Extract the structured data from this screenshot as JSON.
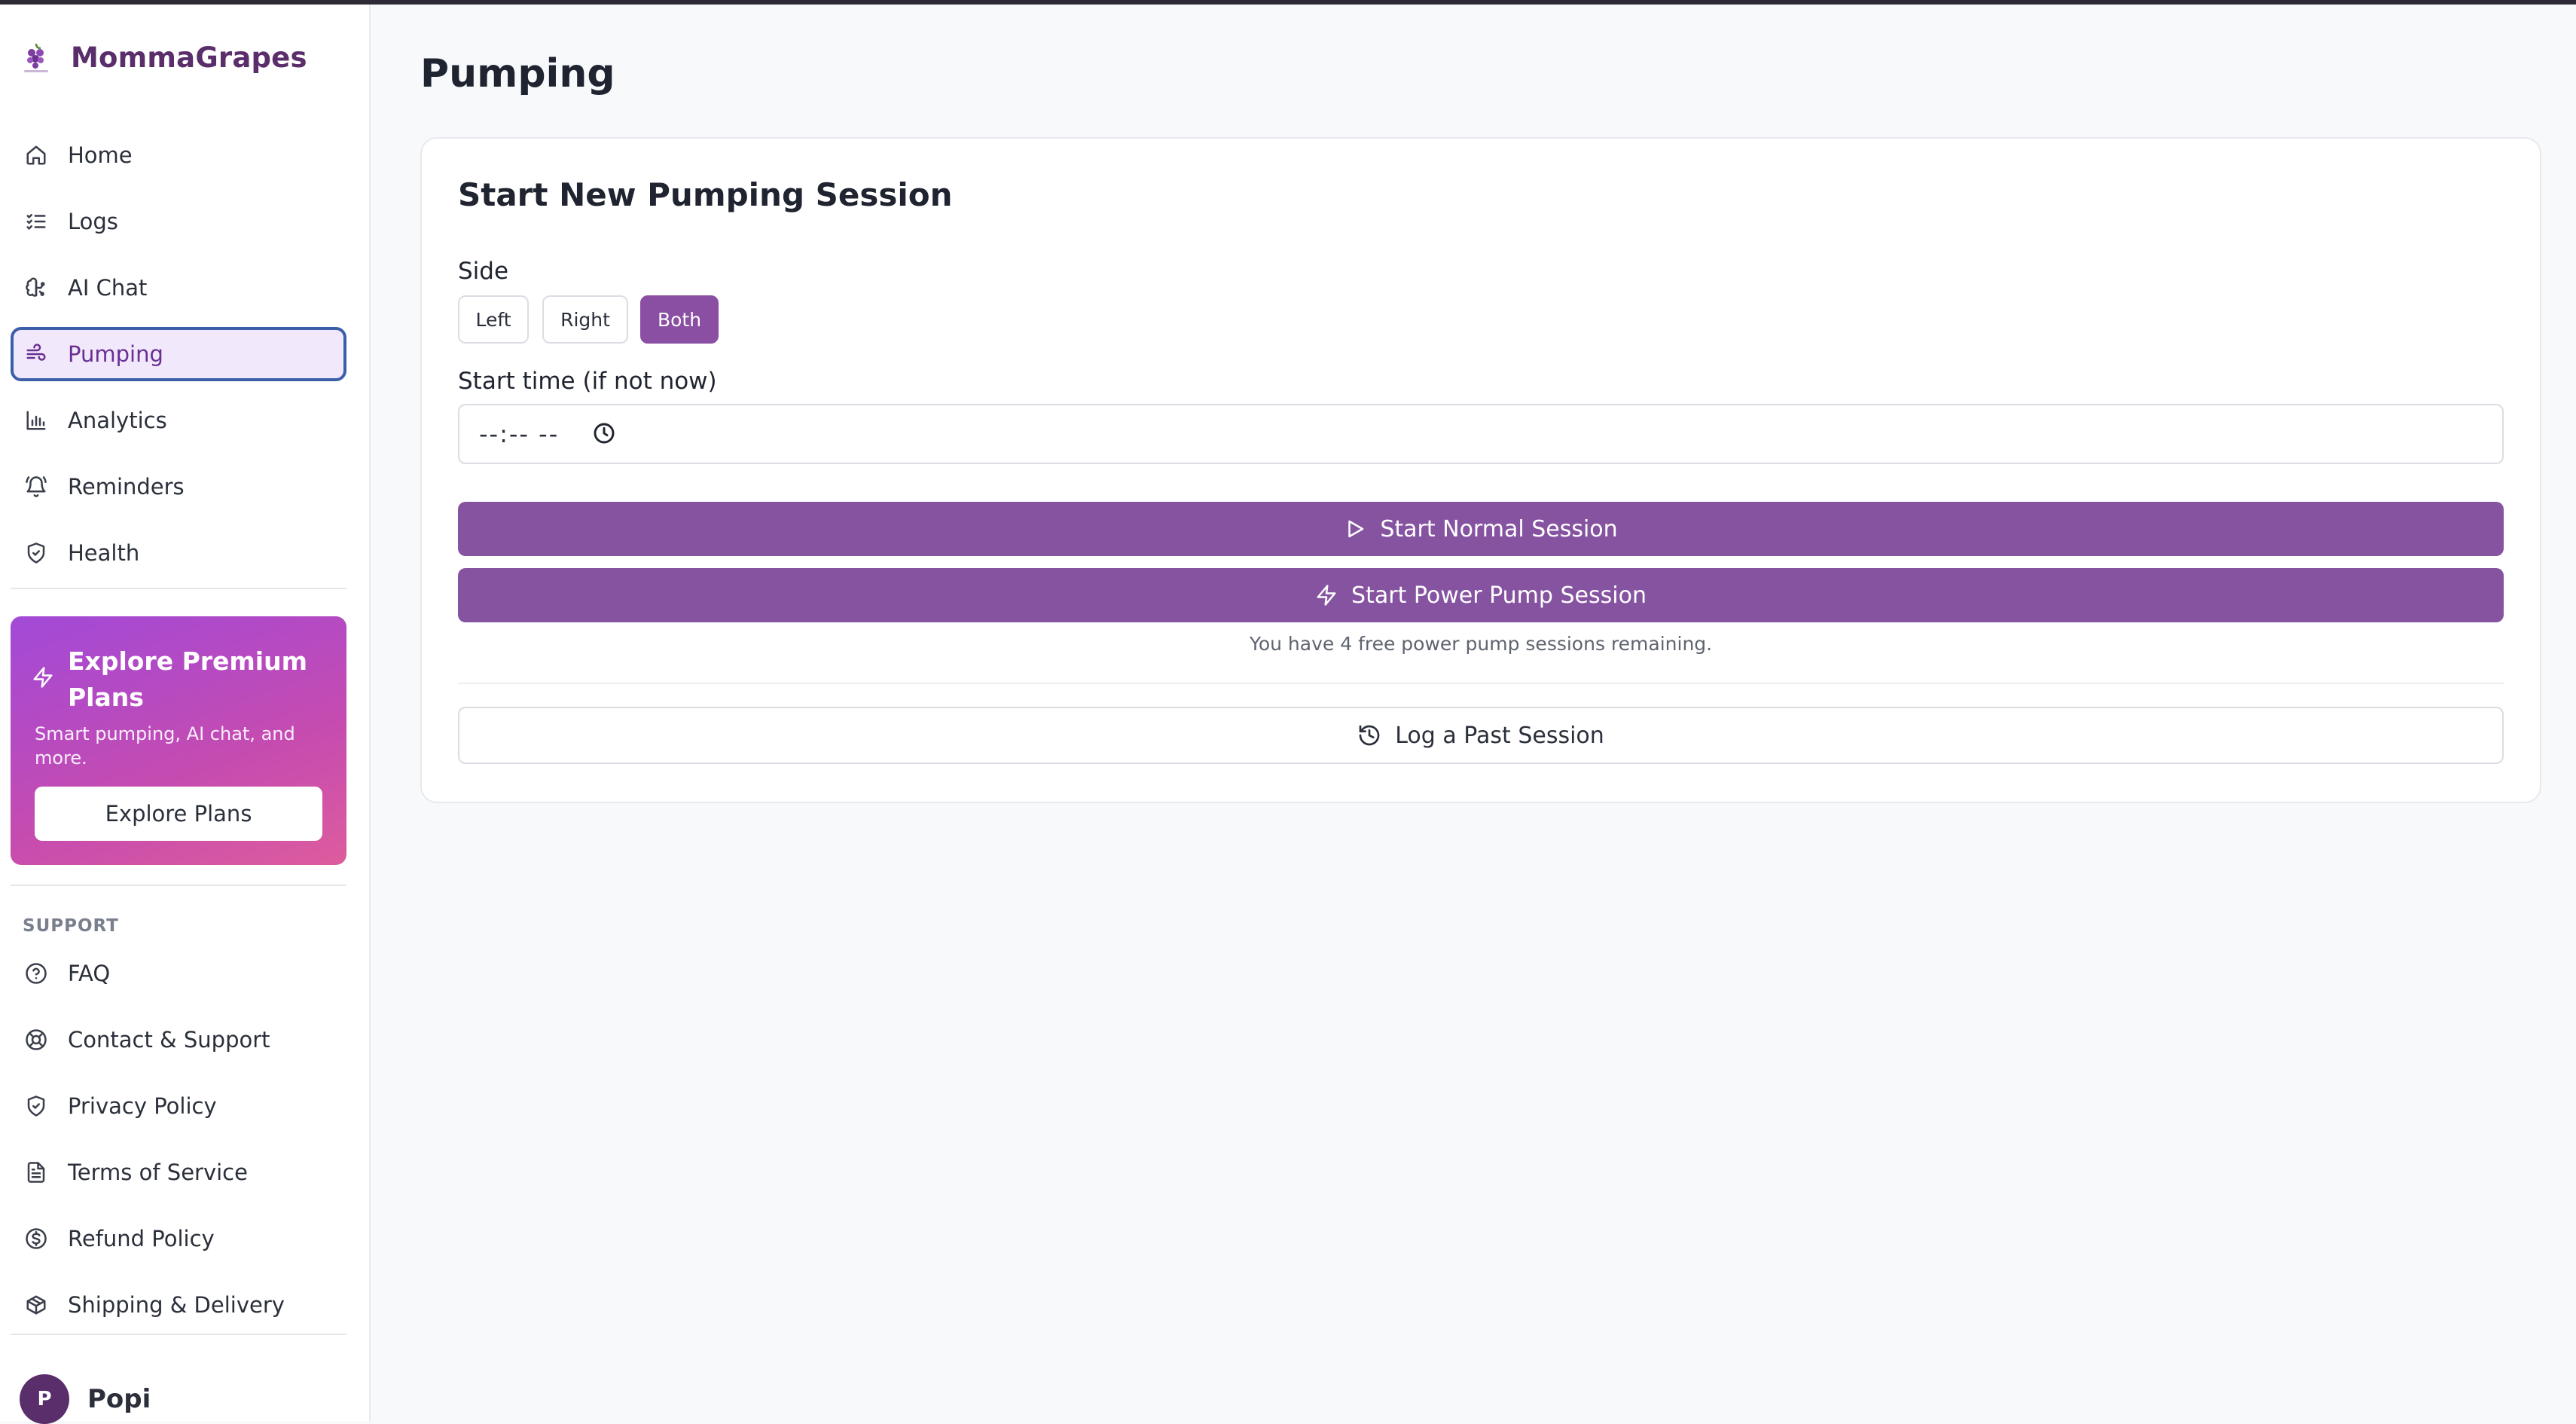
{
  "app": {
    "name": "MommaGrapes"
  },
  "nav": {
    "items": [
      {
        "label": "Home",
        "icon": "home-icon"
      },
      {
        "label": "Logs",
        "icon": "list-checks-icon"
      },
      {
        "label": "AI Chat",
        "icon": "brain-icon"
      },
      {
        "label": "Pumping",
        "icon": "wind-icon",
        "active": true
      },
      {
        "label": "Analytics",
        "icon": "bar-chart-icon"
      },
      {
        "label": "Reminders",
        "icon": "bell-icon"
      },
      {
        "label": "Health",
        "icon": "shield-check-icon"
      }
    ]
  },
  "promo": {
    "title": "Explore Premium Plans",
    "description": "Smart pumping, AI chat, and more.",
    "button": "Explore Plans"
  },
  "support": {
    "label": "SUPPORT",
    "items": [
      {
        "label": "FAQ",
        "icon": "help-circle-icon"
      },
      {
        "label": "Contact & Support",
        "icon": "life-buoy-icon"
      },
      {
        "label": "Privacy Policy",
        "icon": "shield-icon"
      },
      {
        "label": "Terms of Service",
        "icon": "file-text-icon"
      },
      {
        "label": "Refund Policy",
        "icon": "dollar-circle-icon"
      },
      {
        "label": "Shipping & Delivery",
        "icon": "package-icon"
      }
    ]
  },
  "user": {
    "initial": "P",
    "name": "Popi"
  },
  "page": {
    "title": "Pumping"
  },
  "session": {
    "title": "Start New Pumping Session",
    "side_label": "Side",
    "sides": [
      "Left",
      "Right",
      "Both"
    ],
    "selected_side": "Both",
    "start_time_label": "Start time (if not now)",
    "start_time_value": "--:-- --",
    "normal_button": "Start Normal Session",
    "power_button": "Start Power Pump Session",
    "remaining_note": "You have 4 free power pump sessions remaining.",
    "past_button": "Log a Past Session"
  },
  "colors": {
    "brand": "#5a2d6b",
    "primary": "#8653a1",
    "active_nav_bg": "#f1e8fb",
    "active_nav_border": "#3b5fa8"
  }
}
